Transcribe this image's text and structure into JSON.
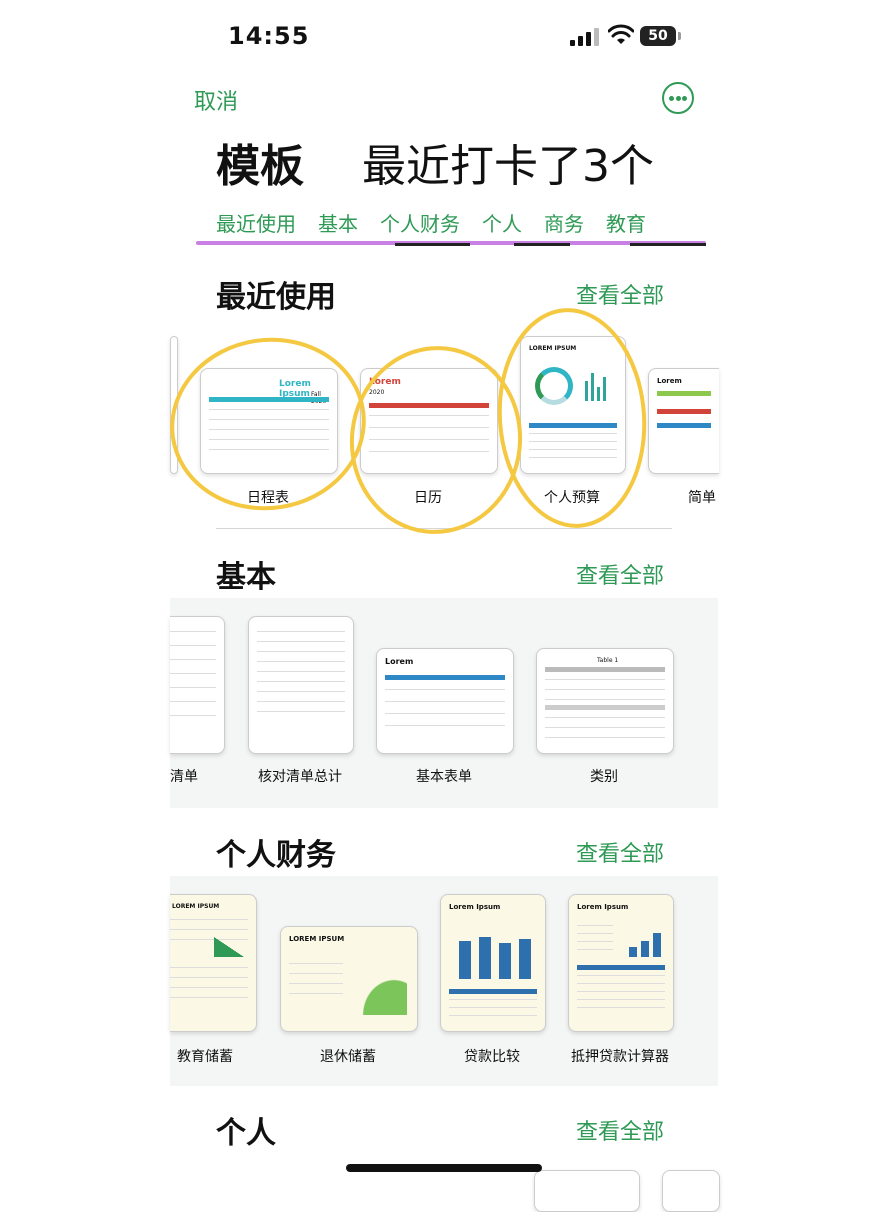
{
  "status": {
    "time": "14:55",
    "battery": "50"
  },
  "nav": {
    "cancel": "取消",
    "more_icon": "ellipsis-circle-icon"
  },
  "header": {
    "title": "模板",
    "annotation": "最近打卡了3个"
  },
  "tabs": [
    "最近使用",
    "基本",
    "个人财务",
    "个人",
    "商务",
    "教育"
  ],
  "sections": {
    "recent": {
      "title": "最近使用",
      "see_all": "查看全部",
      "items": [
        {
          "label": "日程表",
          "thumb_title": "Lorem Ipsum",
          "thumb_sub": "Fall 2020"
        },
        {
          "label": "日历",
          "thumb_title": "Lorem",
          "thumb_sub": "2020"
        },
        {
          "label": "个人预算",
          "thumb_title": "LOREM IPSUM"
        },
        {
          "label": "简单",
          "thumb_title": "Lorem"
        }
      ]
    },
    "basic": {
      "title": "基本",
      "see_all": "查看全部",
      "items": [
        {
          "label": "清单"
        },
        {
          "label": "核对清单总计"
        },
        {
          "label": "基本表单",
          "thumb_title": "Lorem"
        },
        {
          "label": "类别",
          "thumb_title": "Table 1"
        }
      ]
    },
    "finance": {
      "title": "个人财务",
      "see_all": "查看全部",
      "items": [
        {
          "label": "教育储蓄",
          "thumb_title": "LOREM IPSUM"
        },
        {
          "label": "退休储蓄",
          "thumb_title": "LOREM IPSUM"
        },
        {
          "label": "贷款比较",
          "thumb_title": "Lorem Ipsum"
        },
        {
          "label": "抵押贷款计算器",
          "thumb_title": "Lorem Ipsum"
        }
      ]
    },
    "personal": {
      "title": "个人",
      "see_all": "查看全部"
    }
  },
  "colors": {
    "accent": "#2e9a55",
    "highlight": "#f5c842",
    "marker": "#c06ae0"
  }
}
